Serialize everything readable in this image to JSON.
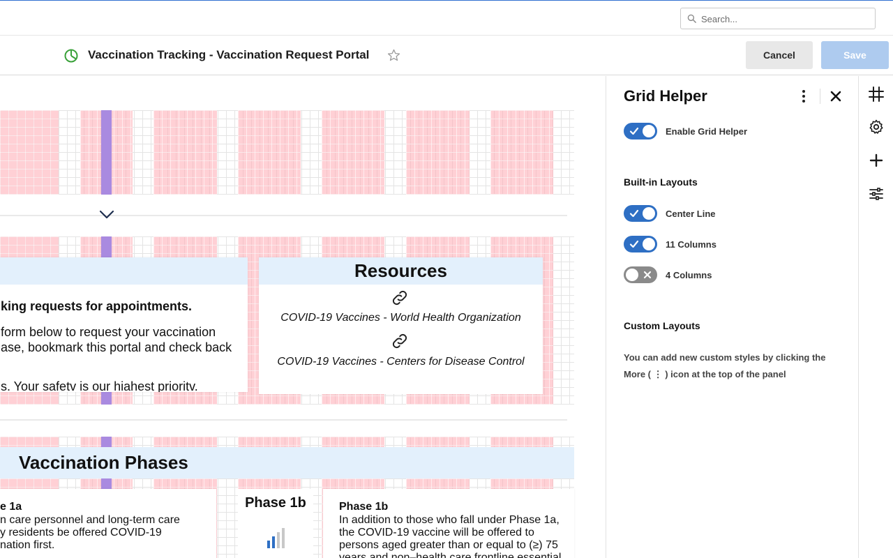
{
  "search": {
    "placeholder": "Search..."
  },
  "header": {
    "title": "Vaccination Tracking - Vaccination Request Portal",
    "cancel_label": "Cancel",
    "save_label": "Save"
  },
  "canvas": {
    "intro": {
      "bold_line": "king requests for appointments.",
      "line1": "form below to request your vaccination",
      "line2": "ase, bookmark this portal and check back",
      "line3": "s. Your safetv is our hiahest prioritv."
    },
    "resources": {
      "title": "Resources",
      "links": [
        "COVID-19 Vaccines - World Health Organization",
        "COVID-19 Vaccines - Centers for Disease Control"
      ]
    },
    "phases": {
      "title": "Vaccination Phases",
      "phase1a_title": "e 1a",
      "phase1a_lines": [
        "n care personnel and long-term care",
        "y residents be offered COVID-19",
        "nation first."
      ],
      "phase1b_heading": "Phase 1b",
      "phase1b_title": "Phase 1b",
      "phase1b_lines": [
        "In addition to those who fall under Phase 1a,",
        "the COVID-19 vaccine will be offered to",
        "persons aged greater than or equal to (≥) 75",
        "years and non–health care frontline essential"
      ]
    }
  },
  "panel": {
    "title": "Grid Helper",
    "enable_label": "Enable Grid Helper",
    "enable_on": true,
    "builtin_heading": "Built-in Layouts",
    "layouts": [
      {
        "label": "Center Line",
        "on": true
      },
      {
        "label": "11 Columns",
        "on": true
      },
      {
        "label": "4 Columns",
        "on": false
      }
    ],
    "custom_heading": "Custom Layouts",
    "custom_help": "You can add new custom styles by clicking the More ( ⋮ ) icon at the top of the panel"
  },
  "rail": {
    "icons": [
      "grid-icon",
      "gear-icon",
      "plus-icon",
      "sliders-icon"
    ]
  },
  "colors": {
    "accent": "#2e6fc4",
    "save_disabled": "#aecbef",
    "grid_column": "#ffaab2",
    "center_line": "#a98ae0",
    "card_header": "#e3f0fc",
    "page_icon": "#3aa13a"
  }
}
